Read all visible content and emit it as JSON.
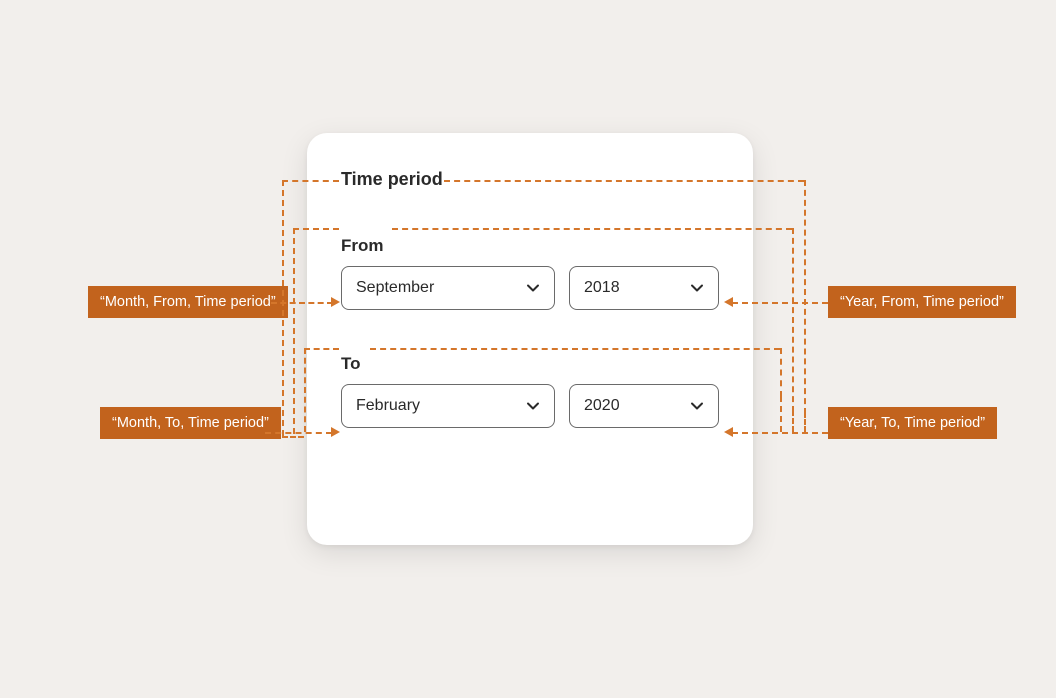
{
  "card": {
    "title": "Time period",
    "from": {
      "label": "From",
      "month": "September",
      "year": "2018"
    },
    "to": {
      "label": "To",
      "month": "February",
      "year": "2020"
    }
  },
  "annotations": {
    "from_month": "“Month, From, Time period”",
    "from_year": "“Year, From, Time period”",
    "to_month": "“Month, To, Time period”",
    "to_year": "“Year, To, Time period”"
  },
  "colors": {
    "accent": "#c2631d",
    "dash": "#d4762b"
  }
}
